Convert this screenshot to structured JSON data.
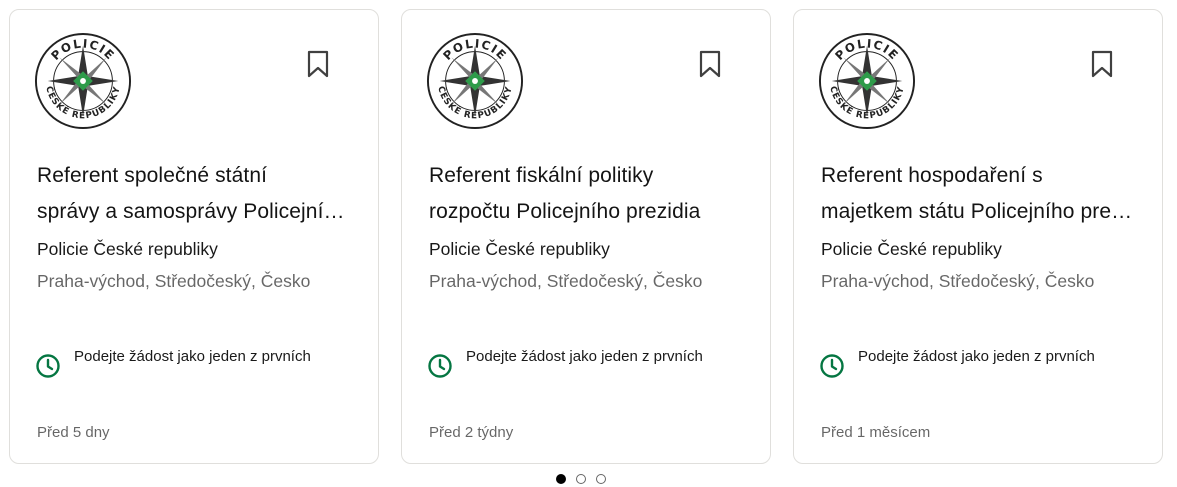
{
  "jobs": [
    {
      "title_line1": "Referent společné státní",
      "title_line2": "správy a samosprávy Policejního prezidia",
      "company": "Policie České republiky",
      "location": "Praha-východ, Středočeský, Česko",
      "insight": "Podejte žádost jako jeden z prvních",
      "time": "Před 5 dny",
      "logo_text_top": "POLICIE",
      "logo_text_bottom": "ČESKÉ REPUBLIKY",
      "icon": "bookmark-icon"
    },
    {
      "title_line1": "Referent fiskální politiky",
      "title_line2": "rozpočtu Policejního prezidia",
      "company": "Policie České republiky",
      "location": "Praha-východ, Středočeský, Česko",
      "insight": "Podejte žádost jako jeden z prvních",
      "time": "Před 2 týdny",
      "logo_text_top": "POLICIE",
      "logo_text_bottom": "ČESKÉ REPUBLIKY",
      "icon": "bookmark-icon"
    },
    {
      "title_line1": "Referent hospodaření s",
      "title_line2": "majetkem státu Policejního prezidia",
      "company": "Policie České republiky",
      "location": "Praha-východ, Středočeský, Česko",
      "insight": "Podejte žádost jako jeden z prvních",
      "time": "Před 1 měsícem",
      "logo_text_top": "POLICIE",
      "logo_text_bottom": "ČESKÉ REPUBLIKY",
      "icon": "bookmark-icon"
    }
  ],
  "pagination": {
    "total": 3,
    "active": 1
  },
  "colors": {
    "insight_icon": "#057642",
    "logo_green": "#2e9b4a",
    "text_secondary": "#666666"
  }
}
